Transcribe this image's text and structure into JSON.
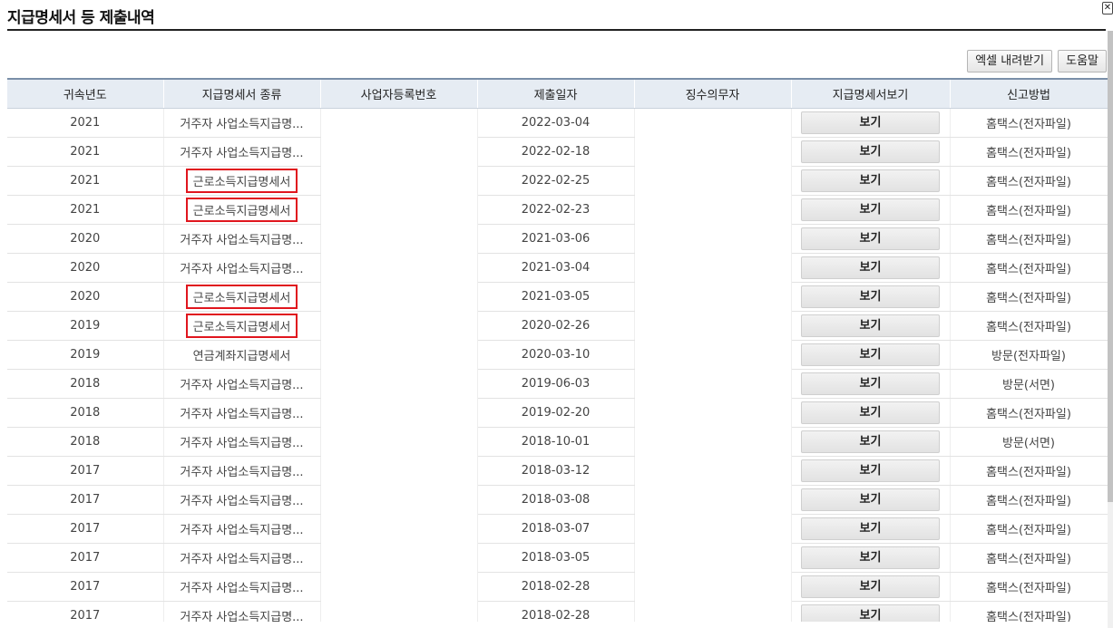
{
  "page": {
    "title": "지급명세서 등 제출내역"
  },
  "toolbar": {
    "excel_label": "엑셀 내려받기",
    "help_label": "도움말"
  },
  "table": {
    "headers": [
      "귀속년도",
      "지급명세서 종류",
      "사업자등록번호",
      "제출일자",
      "징수의무자",
      "지급명세서보기",
      "신고방법"
    ],
    "view_label": "보기",
    "rows": [
      {
        "year": "2021",
        "kind": "거주자 사업소득지급명...",
        "date": "2022-03-04",
        "method": "홈택스(전자파일)",
        "highlighted": false
      },
      {
        "year": "2021",
        "kind": "거주자 사업소득지급명...",
        "date": "2022-02-18",
        "method": "홈택스(전자파일)",
        "highlighted": false
      },
      {
        "year": "2021",
        "kind": "근로소득지급명세서",
        "date": "2022-02-25",
        "method": "홈택스(전자파일)",
        "highlighted": true
      },
      {
        "year": "2021",
        "kind": "근로소득지급명세서",
        "date": "2022-02-23",
        "method": "홈택스(전자파일)",
        "highlighted": true
      },
      {
        "year": "2020",
        "kind": "거주자 사업소득지급명...",
        "date": "2021-03-06",
        "method": "홈택스(전자파일)",
        "highlighted": false
      },
      {
        "year": "2020",
        "kind": "거주자 사업소득지급명...",
        "date": "2021-03-04",
        "method": "홈택스(전자파일)",
        "highlighted": false
      },
      {
        "year": "2020",
        "kind": "근로소득지급명세서",
        "date": "2021-03-05",
        "method": "홈택스(전자파일)",
        "highlighted": true
      },
      {
        "year": "2019",
        "kind": "근로소득지급명세서",
        "date": "2020-02-26",
        "method": "홈택스(전자파일)",
        "highlighted": true
      },
      {
        "year": "2019",
        "kind": "연금계좌지급명세서",
        "date": "2020-03-10",
        "method": "방문(전자파일)",
        "highlighted": false
      },
      {
        "year": "2018",
        "kind": "거주자 사업소득지급명...",
        "date": "2019-06-03",
        "method": "방문(서면)",
        "highlighted": false
      },
      {
        "year": "2018",
        "kind": "거주자 사업소득지급명...",
        "date": "2019-02-20",
        "method": "홈택스(전자파일)",
        "highlighted": false
      },
      {
        "year": "2018",
        "kind": "거주자 사업소득지급명...",
        "date": "2018-10-01",
        "method": "방문(서면)",
        "highlighted": false
      },
      {
        "year": "2017",
        "kind": "거주자 사업소득지급명...",
        "date": "2018-03-12",
        "method": "홈택스(전자파일)",
        "highlighted": false
      },
      {
        "year": "2017",
        "kind": "거주자 사업소득지급명...",
        "date": "2018-03-08",
        "method": "홈택스(전자파일)",
        "highlighted": false
      },
      {
        "year": "2017",
        "kind": "거주자 사업소득지급명...",
        "date": "2018-03-07",
        "method": "홈택스(전자파일)",
        "highlighted": false
      },
      {
        "year": "2017",
        "kind": "거주자 사업소득지급명...",
        "date": "2018-03-05",
        "method": "홈택스(전자파일)",
        "highlighted": false
      },
      {
        "year": "2017",
        "kind": "거주자 사업소득지급명...",
        "date": "2018-02-28",
        "method": "홈택스(전자파일)",
        "highlighted": false
      },
      {
        "year": "2017",
        "kind": "거주자 사업소득지급명...",
        "date": "2018-02-28",
        "method": "홈택스(전자파일)",
        "highlighted": false
      }
    ]
  },
  "colors": {
    "highlight": "#e0161e",
    "header_bg": "#e6ecf3"
  },
  "icons": {
    "close": "close-icon"
  }
}
